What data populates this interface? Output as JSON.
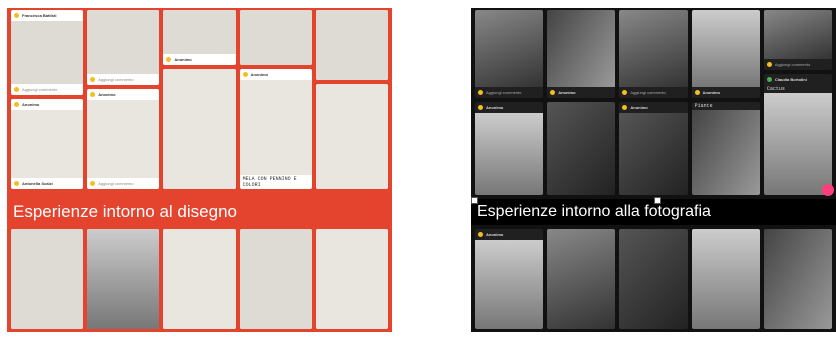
{
  "left": {
    "banner": "Esperienze intorno al disegno",
    "top_meta": [
      "Francesca Battisti",
      "Anonimo",
      "Anonimo",
      "Anonimo",
      "Anonimo"
    ],
    "cap": "MELA CON PENNINO E\nCOLORI",
    "comment_label": "Aggiungi commento",
    "author_low": "Antonella Scalzi"
  },
  "right": {
    "banner": "Esperienze intorno alla fotografia",
    "author": "Anonimo",
    "author2": "Claudia Bortolini",
    "cap1": "Piante",
    "cap2": "Cactus",
    "comment_label": "Aggiungi commento"
  }
}
